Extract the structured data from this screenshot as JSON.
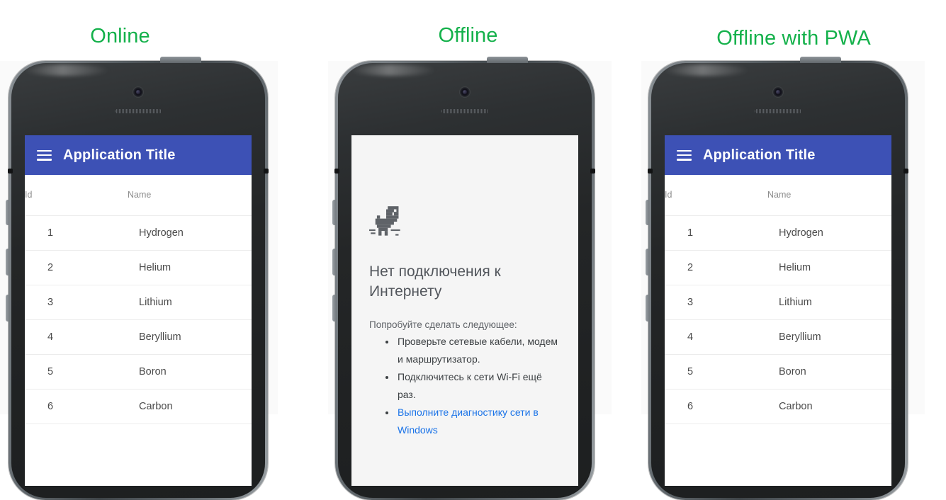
{
  "page": {
    "background": "#ffffff",
    "panel_background": "#fafafa",
    "caption_color": "#14b14b",
    "accent_color": "#3d51b5",
    "link_color": "#1a73e8"
  },
  "columns": [
    {
      "caption": "Online",
      "variant": "app",
      "app": {
        "menu_icon": "hamburger-menu-icon",
        "title": "Application Title",
        "table": {
          "headers": [
            "Id",
            "Name"
          ],
          "rows": [
            [
              "1",
              "Hydrogen"
            ],
            [
              "2",
              "Helium"
            ],
            [
              "3",
              "Lithium"
            ],
            [
              "4",
              "Beryllium"
            ],
            [
              "5",
              "Boron"
            ],
            [
              "6",
              "Carbon"
            ]
          ]
        }
      }
    },
    {
      "caption": "Offline",
      "variant": "error",
      "error": {
        "icon": "dino-offline-icon",
        "title": "Нет подключения к Интернету",
        "subtitle": "Попробуйте сделать следующее:",
        "items": [
          {
            "text": "Проверьте сетевые кабели, модем и маршрутизатор.",
            "link": false
          },
          {
            "text": "Подключитесь к сети Wi-Fi ещё раз.",
            "link": false
          },
          {
            "text": "Выполните диагностику сети в Windows",
            "link": true
          }
        ]
      }
    },
    {
      "caption": "Offline with PWA",
      "variant": "app",
      "app": {
        "menu_icon": "hamburger-menu-icon",
        "title": "Application Title",
        "table": {
          "headers": [
            "Id",
            "Name"
          ],
          "rows": [
            [
              "1",
              "Hydrogen"
            ],
            [
              "2",
              "Helium"
            ],
            [
              "3",
              "Lithium"
            ],
            [
              "4",
              "Beryllium"
            ],
            [
              "5",
              "Boron"
            ],
            [
              "6",
              "Carbon"
            ]
          ]
        }
      }
    }
  ]
}
